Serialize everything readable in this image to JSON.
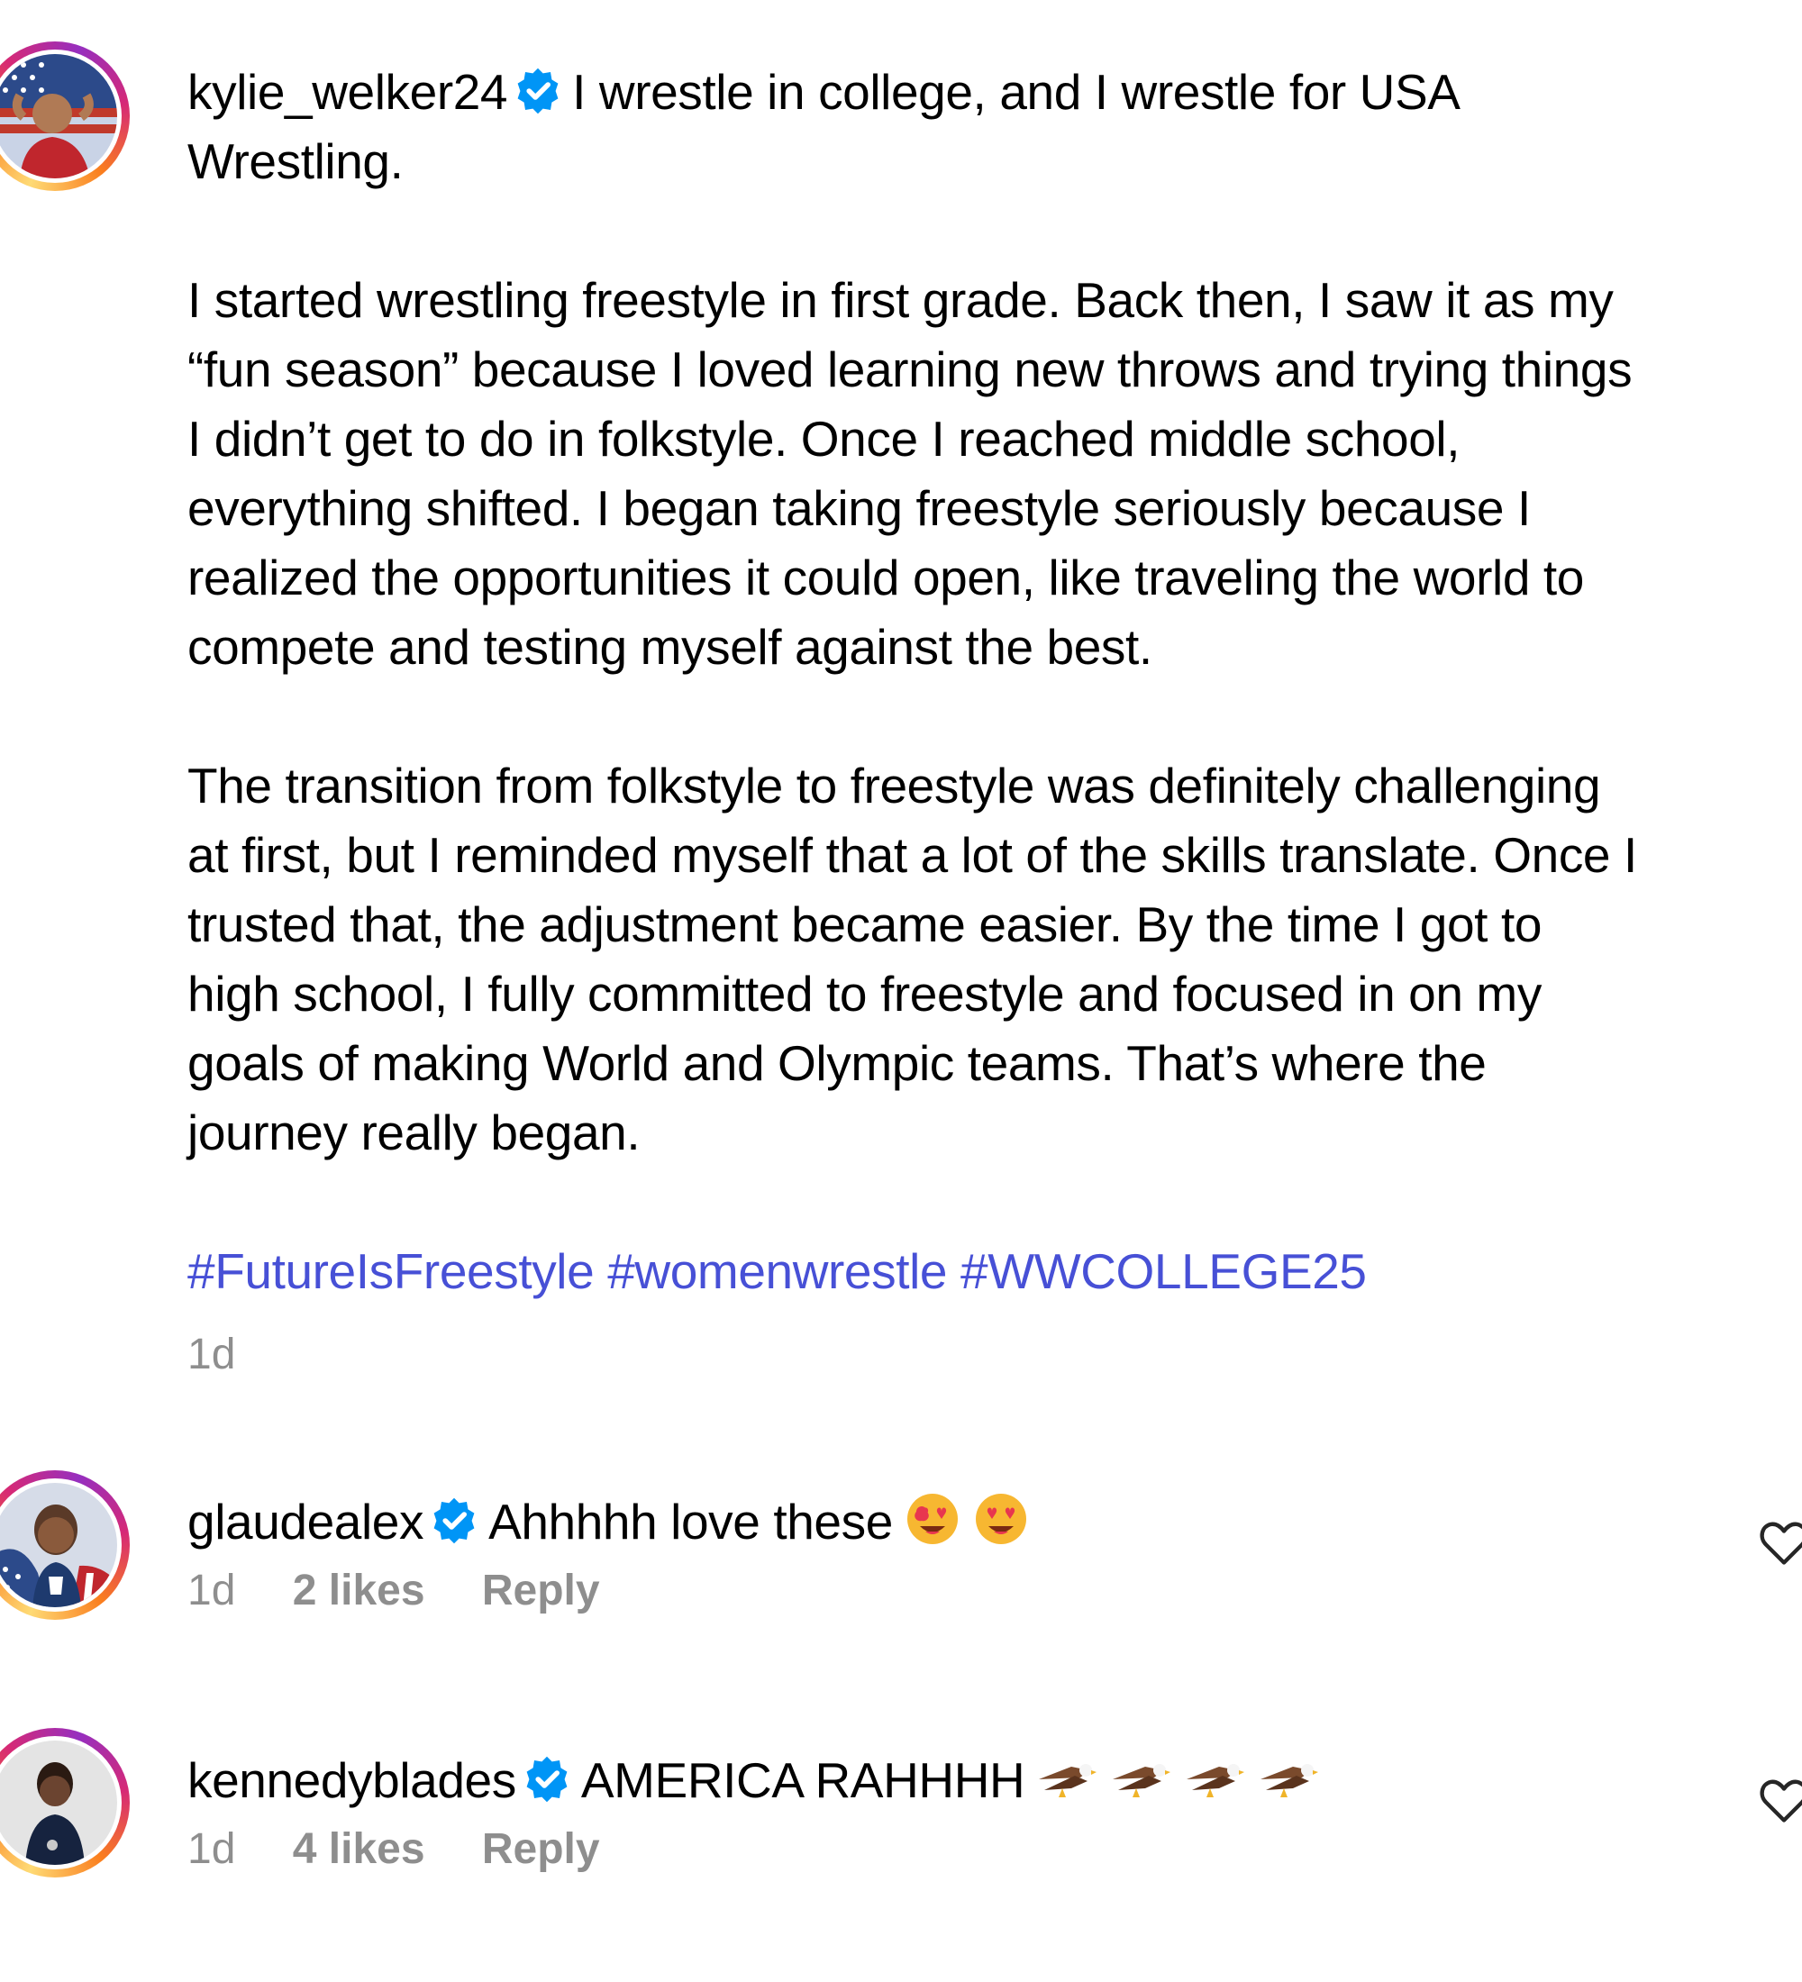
{
  "post": {
    "username": "kylie_welker24",
    "verified": true,
    "lines": [
      "I wrestle in college, and I wrestle for USA",
      "Wrestling."
    ],
    "paragraph2": [
      "I started wrestling freestyle in first grade. Back then, I saw it as my",
      "“fun season” because I loved learning new throws and trying things",
      "I didn’t get to do in folkstyle. Once I reached middle school,",
      "everything shifted. I began taking freestyle seriously because I",
      "realized the opportunities it could open, like traveling the world to",
      "compete and testing myself against the best."
    ],
    "paragraph3": [
      "The transition from folkstyle to freestyle was definitely challenging",
      "at first, but I reminded myself that a lot of the skills translate. Once I",
      "trusted that, the adjustment became easier. By the time I got to",
      "high school, I fully committed to freestyle and focused in on my",
      "goals of making World and Olympic teams. That’s where the",
      "journey really began."
    ],
    "hashtags": [
      "#FutureIsFreestyle",
      "#womenwrestle",
      "#WWCOLLEGE25"
    ],
    "time": "1d"
  },
  "comments": [
    {
      "username": "glaudealex",
      "verified": true,
      "text": "Ahhhhh love these",
      "emoji": [
        "smiling-face-with-heart-eyes",
        "smiling-face-with-heart-eyes"
      ],
      "time": "1d",
      "likes": "2 likes",
      "reply": "Reply"
    },
    {
      "username": "kennedyblades",
      "verified": true,
      "text": "AMERICA RAHHHH",
      "emoji": [
        "eagle",
        "eagle",
        "eagle",
        "eagle"
      ],
      "time": "1d",
      "likes": "4 likes",
      "reply": "Reply"
    }
  ],
  "colors": {
    "text": "#000000",
    "muted": "#8e8e8e",
    "hashtag": "#4750d6",
    "verified": "#0095f6"
  },
  "icons": {
    "verified": "verified-badge-icon",
    "like": "heart-outline-icon"
  }
}
